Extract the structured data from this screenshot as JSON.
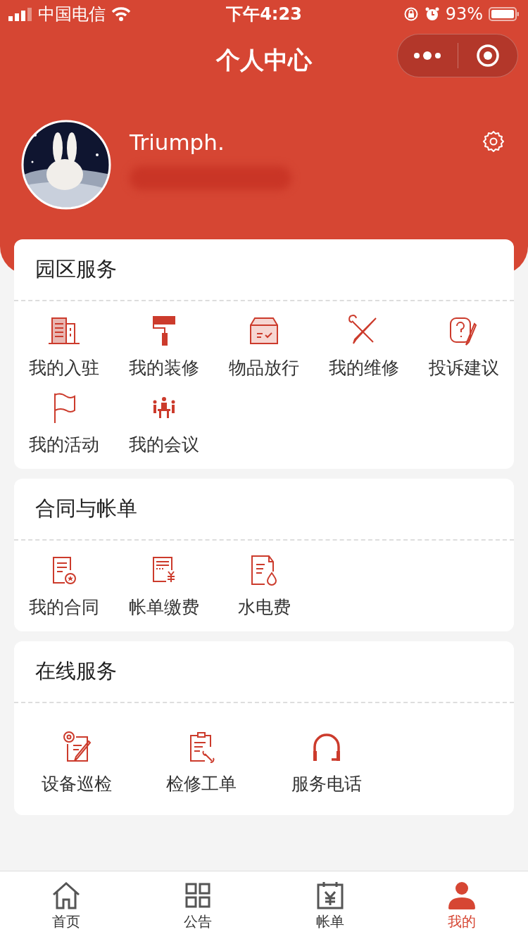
{
  "status_bar": {
    "carrier": "中国电信",
    "time": "下午4:23",
    "battery": "93%"
  },
  "nav": {
    "title": "个人中心"
  },
  "profile": {
    "name": "Triumph."
  },
  "sections": [
    {
      "title": "园区服务",
      "items": [
        {
          "label": "我的入驻"
        },
        {
          "label": "我的装修"
        },
        {
          "label": "物品放行"
        },
        {
          "label": "我的维修"
        },
        {
          "label": "投诉建议"
        },
        {
          "label": "我的活动"
        },
        {
          "label": "我的会议"
        }
      ]
    },
    {
      "title": "合同与帐单",
      "items": [
        {
          "label": "我的合同"
        },
        {
          "label": "帐单缴费"
        },
        {
          "label": "水电费"
        }
      ]
    },
    {
      "title": "在线服务",
      "items": [
        {
          "label": "设备巡检"
        },
        {
          "label": "检修工单"
        },
        {
          "label": "服务电话"
        }
      ]
    }
  ],
  "tabs": [
    {
      "label": "首页",
      "selected": false
    },
    {
      "label": "公告",
      "selected": false
    },
    {
      "label": "帐单",
      "selected": false
    },
    {
      "label": "我的",
      "selected": true
    }
  ]
}
